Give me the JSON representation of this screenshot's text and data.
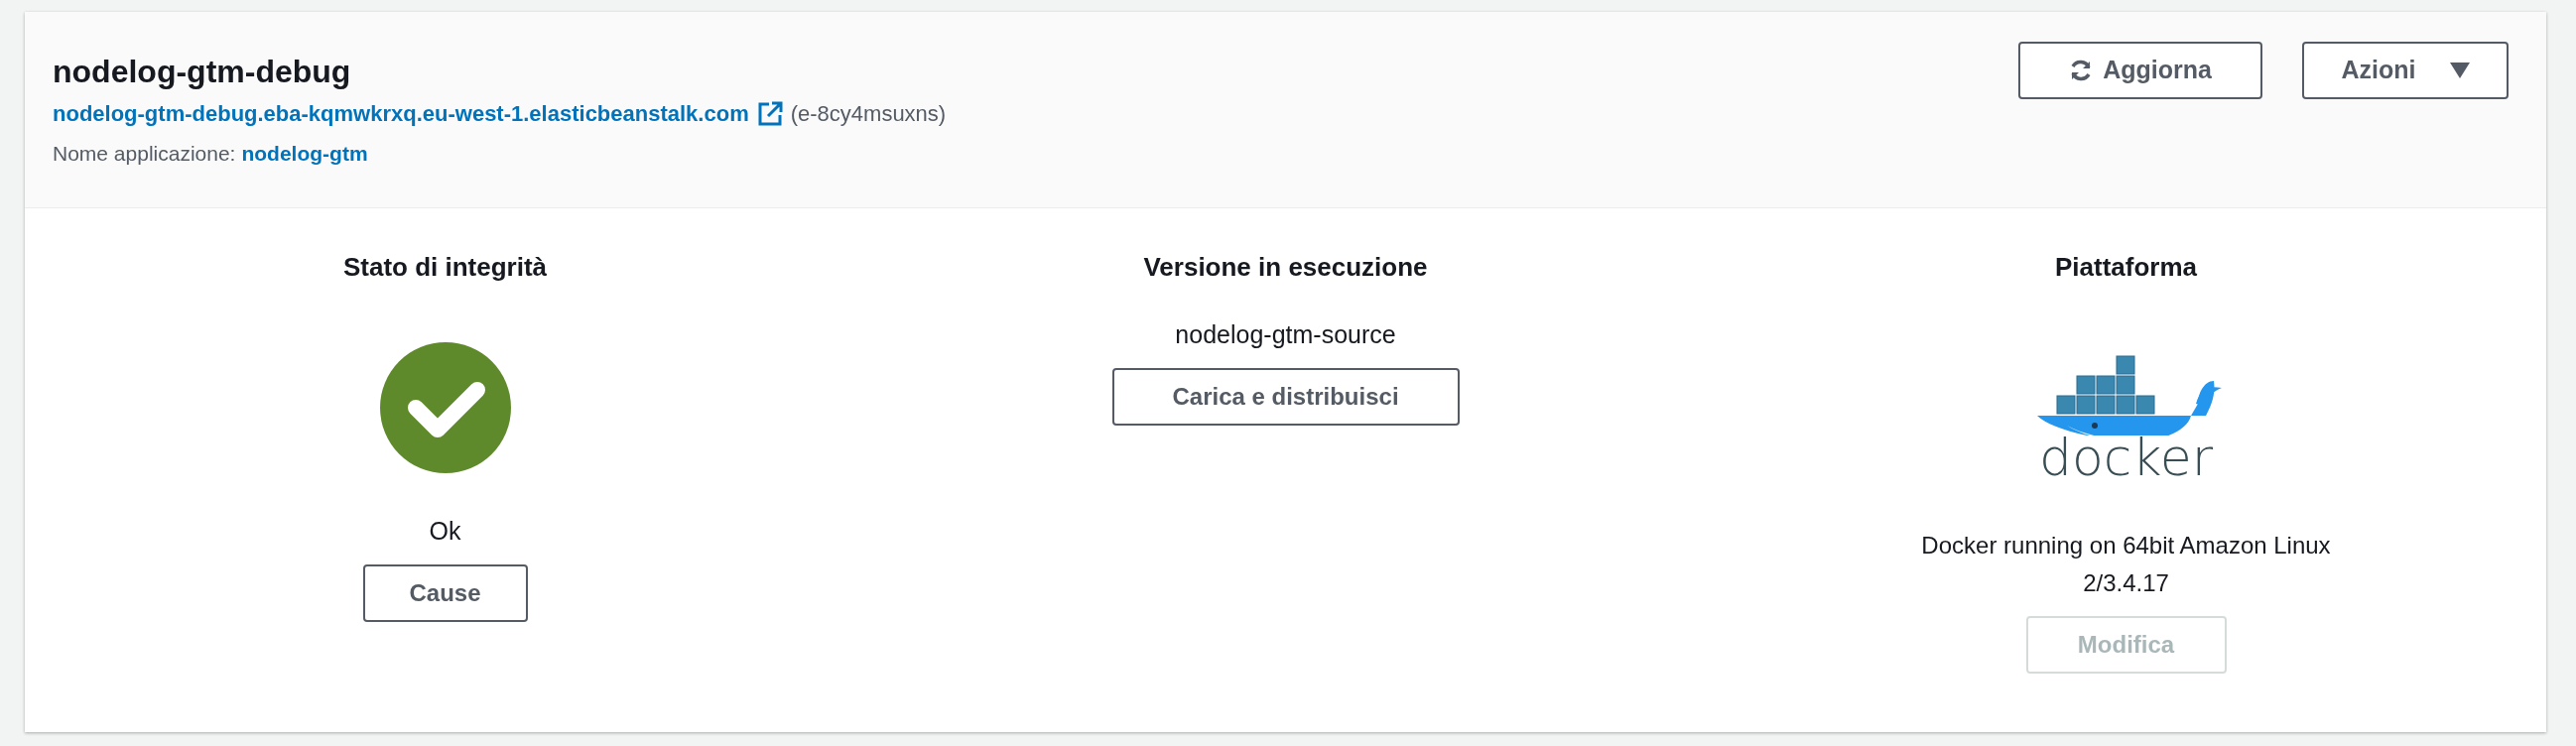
{
  "environment": {
    "title": "nodelog-gtm-debug",
    "url": "nodelog-gtm-debug.eba-kqmwkrxq.eu-west-1.elasticbeanstalk.com",
    "environment_id": "(e-8cy4msuxns)",
    "application_label": "Nome applicazione:",
    "application_name": "nodelog-gtm"
  },
  "actions": [
    {
      "label": "Aggiorna",
      "kind": "refresh"
    },
    {
      "label": "Azioni",
      "kind": "dropdown"
    }
  ],
  "panels": [
    {
      "kind": "health",
      "heading": "Stato di integrità",
      "value": "Ok",
      "button": {
        "label": "Cause",
        "disabled": false
      }
    },
    {
      "kind": "version",
      "heading": "Versione in esecuzione",
      "value": "nodelog-gtm-source",
      "button": {
        "label": "Carica e distribuisci",
        "disabled": false
      }
    },
    {
      "kind": "platform",
      "heading": "Piattaforma",
      "logo_text": "docker",
      "value": "Docker running on 64bit Amazon Linux 2/3.4.17",
      "button": {
        "label": "Modifica",
        "disabled": true
      }
    }
  ]
}
